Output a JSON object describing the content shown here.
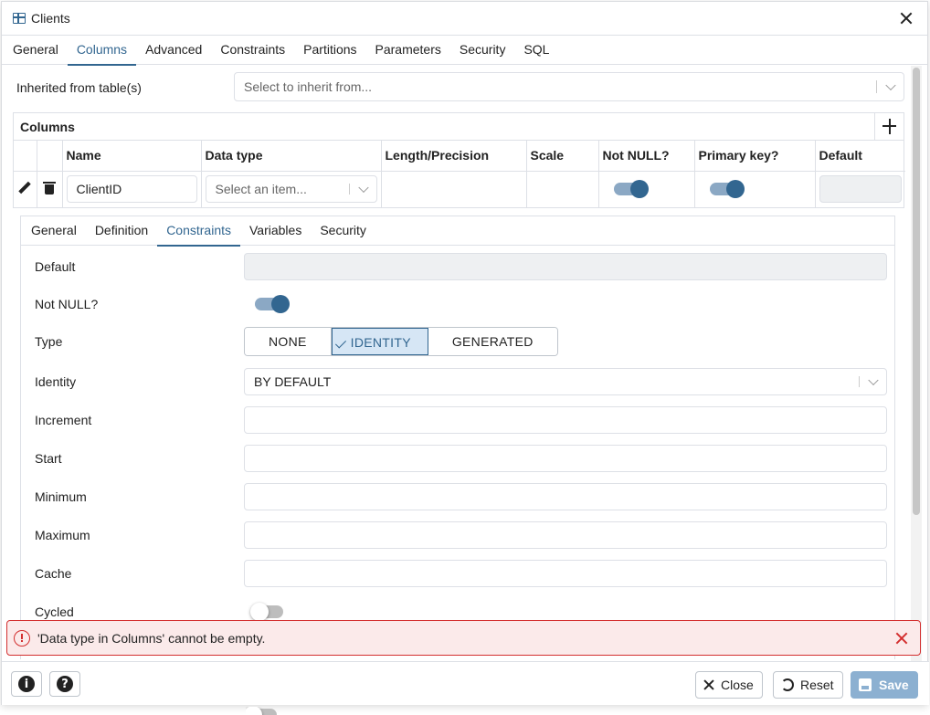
{
  "dialog": {
    "title": "Clients"
  },
  "main_tabs": [
    {
      "label": "General"
    },
    {
      "label": "Columns"
    },
    {
      "label": "Advanced"
    },
    {
      "label": "Constraints"
    },
    {
      "label": "Partitions"
    },
    {
      "label": "Parameters"
    },
    {
      "label": "Security"
    },
    {
      "label": "SQL"
    }
  ],
  "active_main_tab": "Columns",
  "inherit": {
    "label": "Inherited from table(s)",
    "placeholder": "Select to inherit from..."
  },
  "columns": {
    "title": "Columns",
    "headers": [
      "Name",
      "Data type",
      "Length/Precision",
      "Scale",
      "Not NULL?",
      "Primary key?",
      "Default"
    ],
    "rows": [
      {
        "name": "ClientID",
        "data_type_placeholder": "Select an item...",
        "length": "",
        "scale": "",
        "not_null": true,
        "primary_key": true,
        "default": ""
      }
    ]
  },
  "sub_tabs": [
    {
      "label": "General"
    },
    {
      "label": "Definition"
    },
    {
      "label": "Constraints"
    },
    {
      "label": "Variables"
    },
    {
      "label": "Security"
    }
  ],
  "active_sub_tab": "Constraints",
  "constraints": {
    "default_label": "Default",
    "not_null_label": "Not NULL?",
    "not_null": true,
    "type_label": "Type",
    "type_options": [
      "NONE",
      "IDENTITY",
      "GENERATED"
    ],
    "type_selected": "IDENTITY",
    "identity_label": "Identity",
    "identity_value": "BY DEFAULT",
    "increment_label": "Increment",
    "start_label": "Start",
    "minimum_label": "Minimum",
    "maximum_label": "Maximum",
    "cache_label": "Cache",
    "cycled_label": "Cycled",
    "cycled": false
  },
  "alert": {
    "message": "'Data type in Columns' cannot be empty.",
    "color": "#d32f2f"
  },
  "footer": {
    "info_label": "i",
    "help_label": "?",
    "close_label": "Close",
    "reset_label": "Reset",
    "save_label": "Save"
  },
  "colors": {
    "accent": "#326690",
    "save_disabled": "#8cb0d1"
  }
}
